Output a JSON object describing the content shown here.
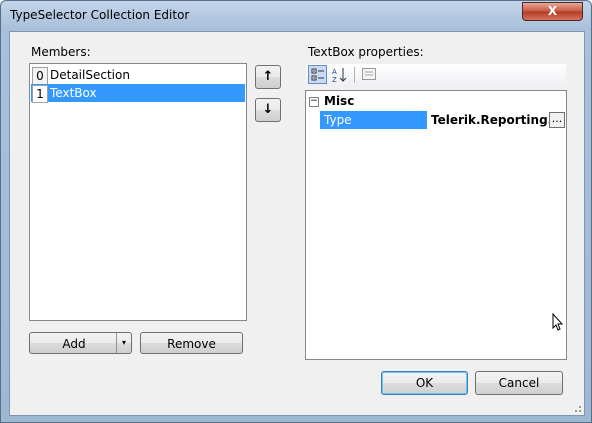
{
  "window": {
    "title": "TypeSelector Collection Editor",
    "close_label": "X"
  },
  "members": {
    "label": "Members:",
    "items": [
      {
        "index": "0",
        "label": "DetailSection",
        "selected": false
      },
      {
        "index": "1",
        "label": "TextBox",
        "selected": true
      }
    ],
    "add_label": "Add",
    "add_dropdown_arrow": "▾",
    "remove_label": "Remove",
    "move_up_arrow": "↑",
    "move_down_arrow": "↓"
  },
  "properties": {
    "label": "TextBox properties:",
    "toolbar": [
      {
        "icon": "categorized-icon",
        "active": true
      },
      {
        "icon": "alphabetical-icon",
        "active": false
      },
      {
        "icon": "property-pages-icon",
        "active": false
      }
    ],
    "category": {
      "expander": "⊟",
      "name": "Misc"
    },
    "rows": [
      {
        "name": "Type",
        "value": "Telerik.Reporting.TextBox",
        "button": "..."
      }
    ]
  },
  "footer": {
    "ok_label": "OK",
    "cancel_label": "Cancel"
  },
  "colors": {
    "selection": "#3399ff",
    "close": "#c8553d",
    "frame": "#a9c0da"
  }
}
